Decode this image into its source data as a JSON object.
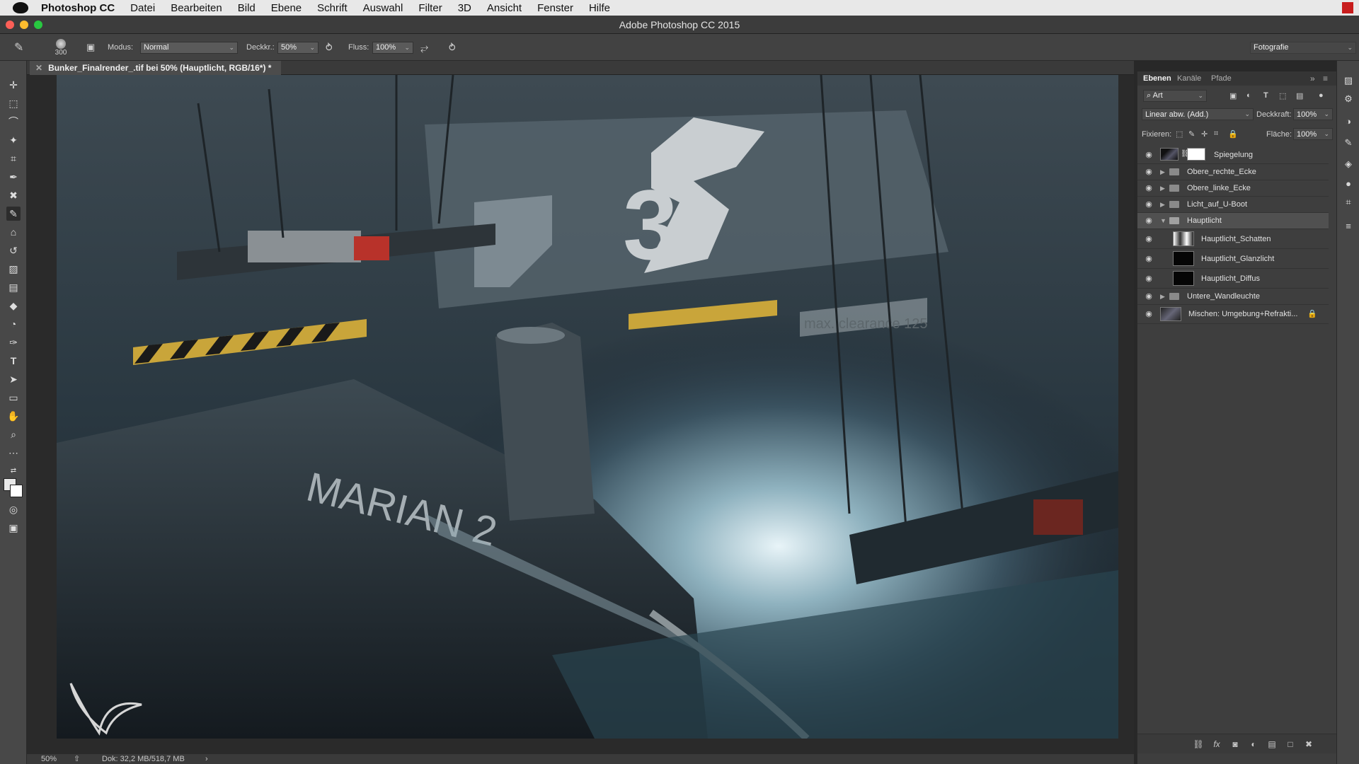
{
  "menubar": {
    "app_name": "Photoshop CC",
    "items": [
      "Datei",
      "Bearbeiten",
      "Bild",
      "Ebene",
      "Schrift",
      "Auswahl",
      "Filter",
      "3D",
      "Ansicht",
      "Fenster",
      "Hilfe"
    ]
  },
  "window": {
    "title": "Adobe Photoshop CC 2015"
  },
  "options": {
    "brush_size": "300",
    "mode_label": "Modus:",
    "mode_value": "Normal",
    "opacity_label": "Deckkr.:",
    "opacity_value": "50%",
    "flow_label": "Fluss:",
    "flow_value": "100%",
    "workspace": "Fotografie"
  },
  "document": {
    "tab_title": "Bunker_Finalrender_.tif bei 50% (Hauptlicht, RGB/16*) *",
    "artwork_text_hull": "MARIAN 2",
    "artwork_text_wall": "3",
    "artwork_text_sign": "max. clearance 125"
  },
  "status": {
    "zoom": "50%",
    "doc": "Dok: 32,2 MB/518,7 MB"
  },
  "layers_panel": {
    "tabs": [
      "Ebenen",
      "Kanäle",
      "Pfade"
    ],
    "filter_label": "Art",
    "blend_mode": "Linear abw. (Add.)",
    "opacity_label": "Deckkraft:",
    "opacity_value": "100%",
    "lock_label": "Fixieren:",
    "fill_label": "Fläche:",
    "fill_value": "100%",
    "layers": [
      {
        "name": "Spiegelung",
        "kind": "layer-mask"
      },
      {
        "name": "Obere_rechte_Ecke",
        "kind": "group"
      },
      {
        "name": "Obere_linke_Ecke",
        "kind": "group"
      },
      {
        "name": "Licht_auf_U-Boot",
        "kind": "group"
      },
      {
        "name": "Hauptlicht",
        "kind": "group-open",
        "selected": true
      },
      {
        "name": "Hauptlicht_Schatten",
        "kind": "child"
      },
      {
        "name": "Hauptlicht_Glanzlicht",
        "kind": "child"
      },
      {
        "name": "Hauptlicht_Diffus",
        "kind": "child"
      },
      {
        "name": "Untere_Wandleuchte",
        "kind": "group"
      },
      {
        "name": "Mischen: Umgebung+Refrakti...",
        "kind": "locked"
      }
    ]
  },
  "colors": {
    "accent_red": "#c81d1d",
    "panel_bg": "#3e3e3e",
    "selected_row": "#505050"
  }
}
